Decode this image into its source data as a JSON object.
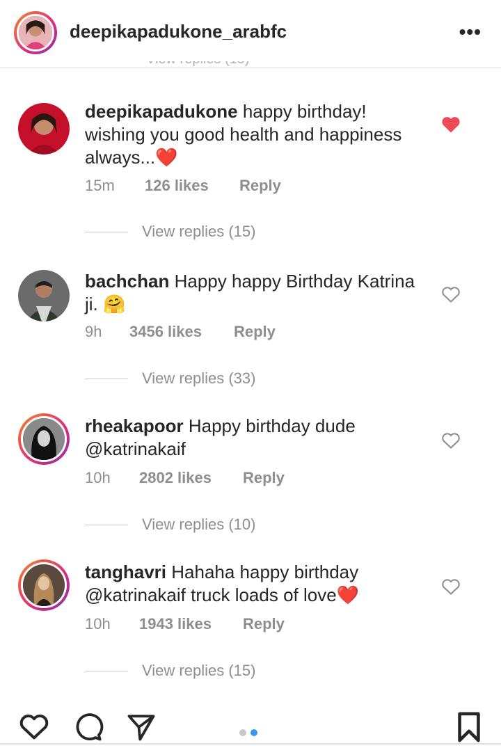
{
  "header": {
    "username": "deepikapadukone_arabfc",
    "more_label": "•••"
  },
  "partial_text": "View replies (15)",
  "comments": [
    {
      "username": "deepikapadukone",
      "text": " happy birthday! wishing you good health and happiness always...",
      "emoji": "❤️",
      "time": "15m",
      "likes": "126 likes",
      "reply": "Reply",
      "view_replies": "View replies (15)",
      "liked": true
    },
    {
      "username": "bachchan",
      "text": " Happy happy Birthday Katrina  ji. ",
      "emoji": "🤗",
      "time": "9h",
      "likes": "3456 likes",
      "reply": "Reply",
      "view_replies": "View replies (33)",
      "liked": false
    },
    {
      "username": "rheakapoor",
      "text": " Happy birthday dude",
      "mention": "@katrinakaif",
      "time": "10h",
      "likes": "2802 likes",
      "reply": "Reply",
      "view_replies": "View replies (10)",
      "liked": false
    },
    {
      "username": "tanghavri",
      "text": " Hahaha happy birthday",
      "mention": "@katrinakaif",
      "text_after": " truck loads of love",
      "emoji": "❤️",
      "time": "10h",
      "likes": "1943 likes",
      "reply": "Reply",
      "view_replies": "View replies (15)",
      "liked": false
    }
  ],
  "icons": {
    "like": "heart-icon",
    "comment": "comment-icon",
    "share": "share-icon",
    "save": "bookmark-icon"
  },
  "carousel": {
    "count": 2,
    "active": 2
  },
  "colors": {
    "heart_red": "#ed4956",
    "accent_blue": "#3897f0",
    "muted": "#8e8e8e"
  }
}
